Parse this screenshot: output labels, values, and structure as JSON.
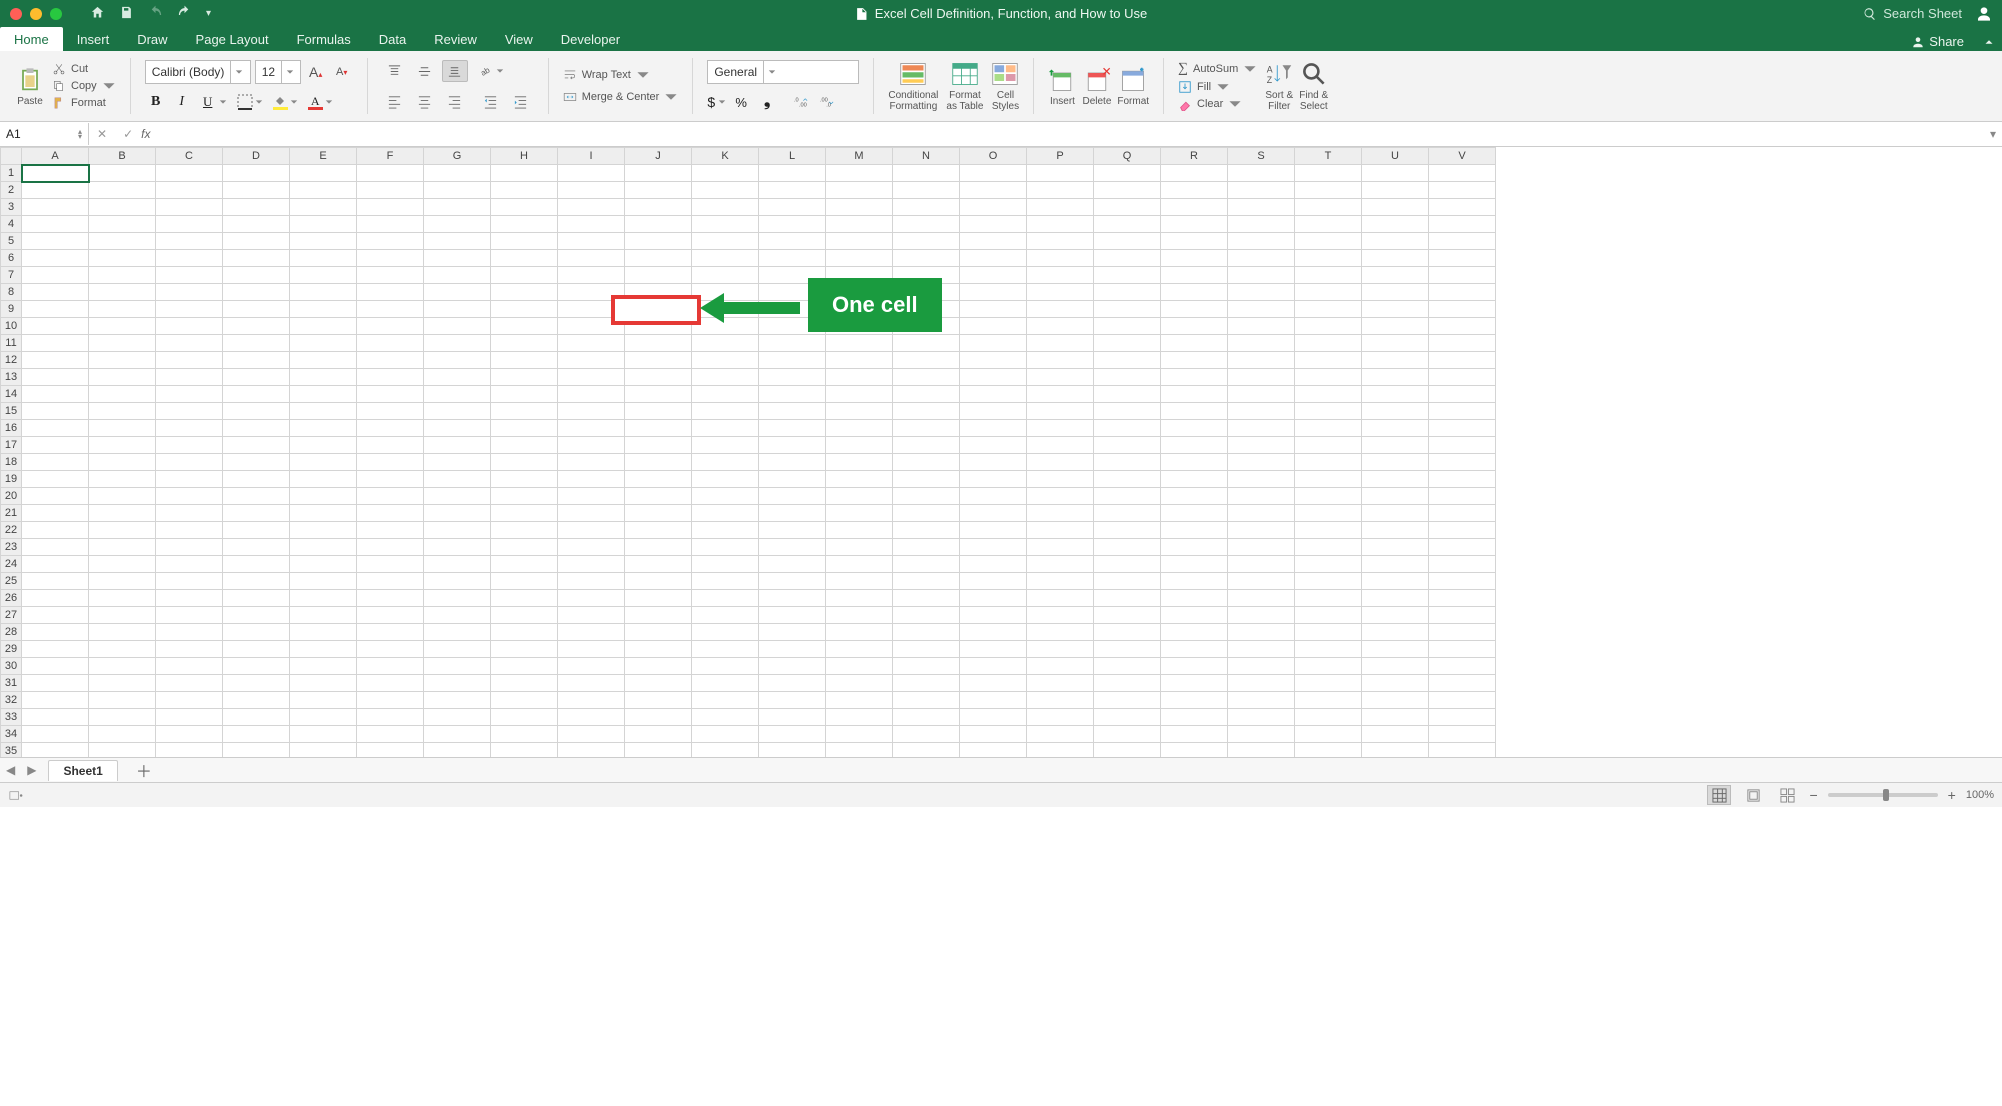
{
  "title": "Excel Cell Definition, Function, and How to Use",
  "search_placeholder": "Search Sheet",
  "tabs": {
    "home": "Home",
    "insert": "Insert",
    "draw": "Draw",
    "page_layout": "Page Layout",
    "formulas": "Formulas",
    "data": "Data",
    "review": "Review",
    "view": "View",
    "developer": "Developer"
  },
  "share_label": "Share",
  "clipboard": {
    "paste": "Paste",
    "cut": "Cut",
    "copy": "Copy",
    "format": "Format"
  },
  "font": {
    "name": "Calibri (Body)",
    "size": "12"
  },
  "wrap": "Wrap Text",
  "merge": "Merge & Center",
  "number_format": "General",
  "btns": {
    "cond": "Conditional\nFormatting",
    "astable": "Format\nas Table",
    "styles": "Cell\nStyles",
    "insert": "Insert",
    "delete": "Delete",
    "format": "Format"
  },
  "editing": {
    "autosum": "AutoSum",
    "fill": "Fill",
    "clear": "Clear",
    "sort": "Sort &\nFilter",
    "find": "Find &\nSelect"
  },
  "namebox": "A1",
  "columns": [
    "A",
    "B",
    "C",
    "D",
    "E",
    "F",
    "G",
    "H",
    "I",
    "J",
    "K",
    "L",
    "M",
    "N",
    "O",
    "P",
    "Q",
    "R",
    "S",
    "T",
    "U",
    "V"
  ],
  "row_count": 36,
  "annotation_label": "One cell",
  "sheet_tab": "Sheet1",
  "zoom": "100%"
}
